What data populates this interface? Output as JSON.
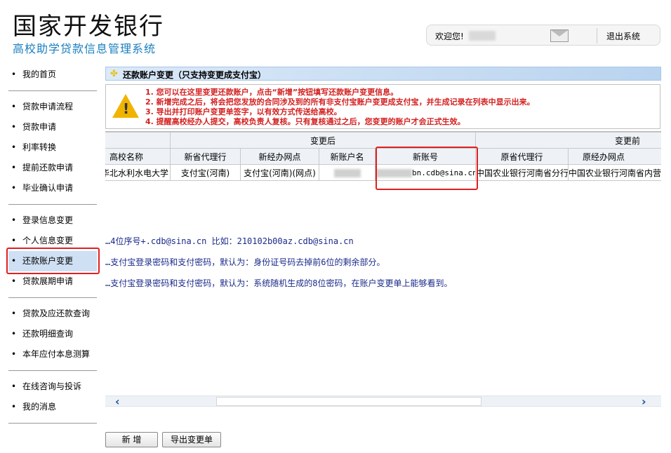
{
  "header": {
    "bank_name": "国家开发银行",
    "system_name": "高校助学贷款信息管理系统",
    "welcome": "欢迎您!",
    "logout": "退出系统"
  },
  "sidebar": {
    "groups": [
      [
        "我的首页"
      ],
      [
        "贷款申请流程",
        "贷款申请",
        "利率转换",
        "提前还款申请",
        "毕业确认申请"
      ],
      [
        "登录信息变更",
        "个人信息变更",
        "还款账户变更",
        "贷款展期申请"
      ],
      [
        "贷款及应还款查询",
        "还款明细查询",
        "本年应付本息测算"
      ],
      [
        "在线咨询与投诉",
        "我的消息"
      ]
    ],
    "active": "还款账户变更"
  },
  "panel": {
    "title": "还款账户变更（只支持变更成支付宝）",
    "notices": [
      "1. 您可以在这里变更还款账户，点击“新增”按钮填写还款账户变更信息。",
      "2. 新增完成之后，将会把您发放的合同涉及到的所有非支付宝账户变更成支付宝，并生成记录在列表中显示出来。",
      "3. 导出并打印账户变更单签字，以有效方式传送给高校。",
      "4. 提醒高校经办人提交，高校负责人复核。只有复核通过之后，您变更的账户才会正式生效。"
    ]
  },
  "table": {
    "group_after": "变更后",
    "group_before": "变更前",
    "columns": [
      "高校名称",
      "新省代理行",
      "新经办网点",
      "新账户名",
      "新账号",
      "原省代理行",
      "原经办网点"
    ],
    "rows": [
      {
        "school": "华北水利水电大学",
        "new_province_bank": "支付宝(河南)",
        "new_branch": "支付宝(河南)(网点)",
        "new_account_name": "",
        "new_account_no": "bn.cdb@sina.cn",
        "old_province_bank": "中国农业银行河南省分行",
        "old_branch": "中国农业银行河南省内营业网点"
      }
    ]
  },
  "hints": [
    "…4位序号+.cdb@sina.cn 比如：210102b00az.cdb@sina.cn",
    "…支付宝登录密码和支付密码，默认为：身份证号码去掉前6位的剩余部分。",
    "…支付宝登录密码和支付密码，默认为：系统随机生成的8位密码，在账户变更单上能够看到。"
  ],
  "buttons": {
    "add": "新 增",
    "export": "导出变更单"
  },
  "icons": {
    "mail": "mail-icon",
    "warning": "warning-icon",
    "star": "star-icon",
    "scroll_left": "chevron-left-icon",
    "scroll_right": "chevron-right-icon"
  },
  "colors": {
    "accent": "#1a7fbf",
    "notice_red": "#d42020",
    "highlight_box": "#e02020",
    "panel_header": "#b9d4ef"
  }
}
